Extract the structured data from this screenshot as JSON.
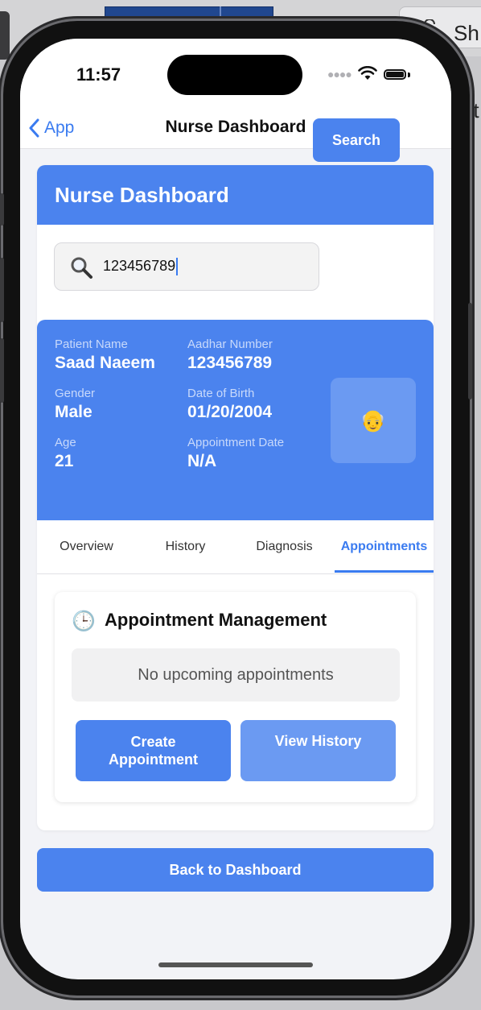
{
  "status_bar": {
    "time": "11:57"
  },
  "nav": {
    "back_label": "App",
    "title": "Nurse Dashboard"
  },
  "card": {
    "header_title": "Nurse Dashboard",
    "search": {
      "value": "123456789",
      "button_label": "Search"
    }
  },
  "patient": {
    "name_label": "Patient Name",
    "name": "Saad Naeem",
    "aadhar_label": "Aadhar Number",
    "aadhar": "123456789",
    "gender_label": "Gender",
    "gender": "Male",
    "dob_label": "Date of Birth",
    "dob": "01/20/2004",
    "age_label": "Age",
    "age": "21",
    "appt_date_label": "Appointment Date",
    "appt_date": "N/A",
    "avatar": "👴"
  },
  "tabs": [
    {
      "label": "Overview",
      "active": false
    },
    {
      "label": "History",
      "active": false
    },
    {
      "label": "Diagnosis",
      "active": false
    },
    {
      "label": "Appointments",
      "active": true
    }
  ],
  "appointments": {
    "icon": "🕒",
    "title": "Appointment Management",
    "empty_text": "No upcoming appointments",
    "create_label": "Create Appointment",
    "history_label": "View History"
  },
  "footer": {
    "back_label": "Back to Dashboard"
  },
  "desktop": {
    "tab_text": "Sh",
    "side_text": "rit"
  },
  "colors": {
    "primary": "#4b83ee",
    "secondary": "#6b9af2",
    "link": "#3a7bf0"
  }
}
